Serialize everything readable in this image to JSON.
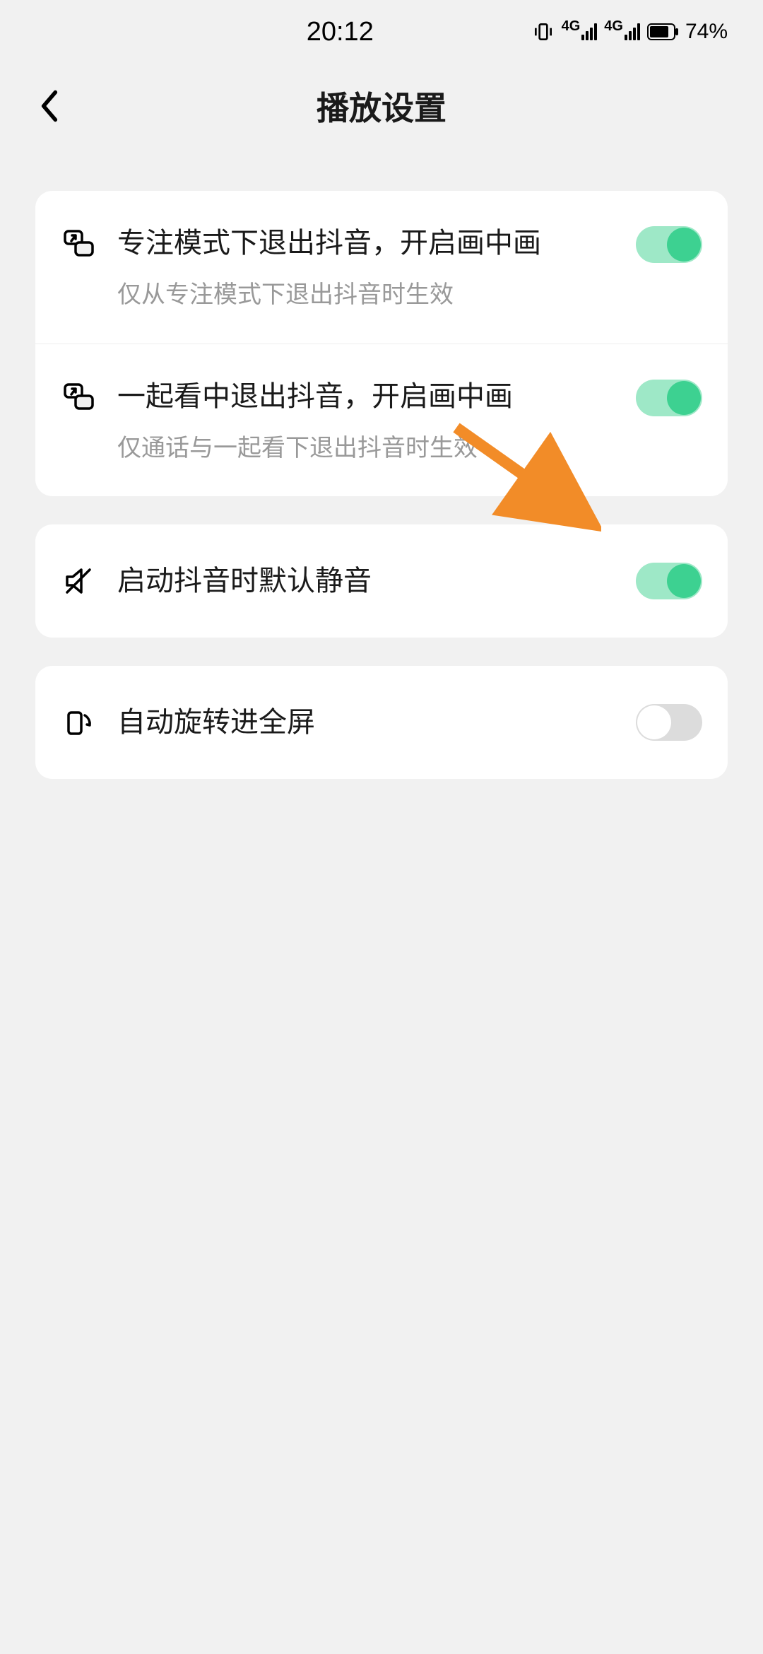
{
  "status_bar": {
    "time": "20:12",
    "network_label_1": "4G",
    "network_label_2": "4G",
    "battery_percent": "74%"
  },
  "header": {
    "title": "播放设置"
  },
  "settings": {
    "group_1": {
      "item_1": {
        "title": "专注模式下退出抖音，开启画中画",
        "subtitle": "仅从专注模式下退出抖音时生效",
        "toggle_on": true
      },
      "item_2": {
        "title": "一起看中退出抖音，开启画中画",
        "subtitle": "仅通话与一起看下退出抖音时生效",
        "toggle_on": true
      }
    },
    "group_2": {
      "item_1": {
        "title": "启动抖音时默认静音",
        "toggle_on": true
      }
    },
    "group_3": {
      "item_1": {
        "title": "自动旋转进全屏",
        "toggle_on": false
      }
    }
  }
}
